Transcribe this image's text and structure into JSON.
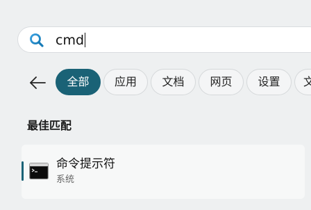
{
  "search": {
    "value": "cmd",
    "icon": "search-icon"
  },
  "filters": {
    "back_icon": "arrow-left-icon",
    "chips": [
      {
        "label": "全部",
        "selected": true
      },
      {
        "label": "应用",
        "selected": false
      },
      {
        "label": "文档",
        "selected": false
      },
      {
        "label": "网页",
        "selected": false
      },
      {
        "label": "设置",
        "selected": false
      },
      {
        "label": "文",
        "selected": false
      }
    ]
  },
  "best_match": {
    "section_title": "最佳匹配",
    "result": {
      "name": "命令提示符",
      "type": "系统",
      "icon": "command-prompt-icon"
    }
  },
  "colors": {
    "accent": "#1a6276",
    "background": "#eef0f1",
    "search_background": "#ffffff"
  }
}
